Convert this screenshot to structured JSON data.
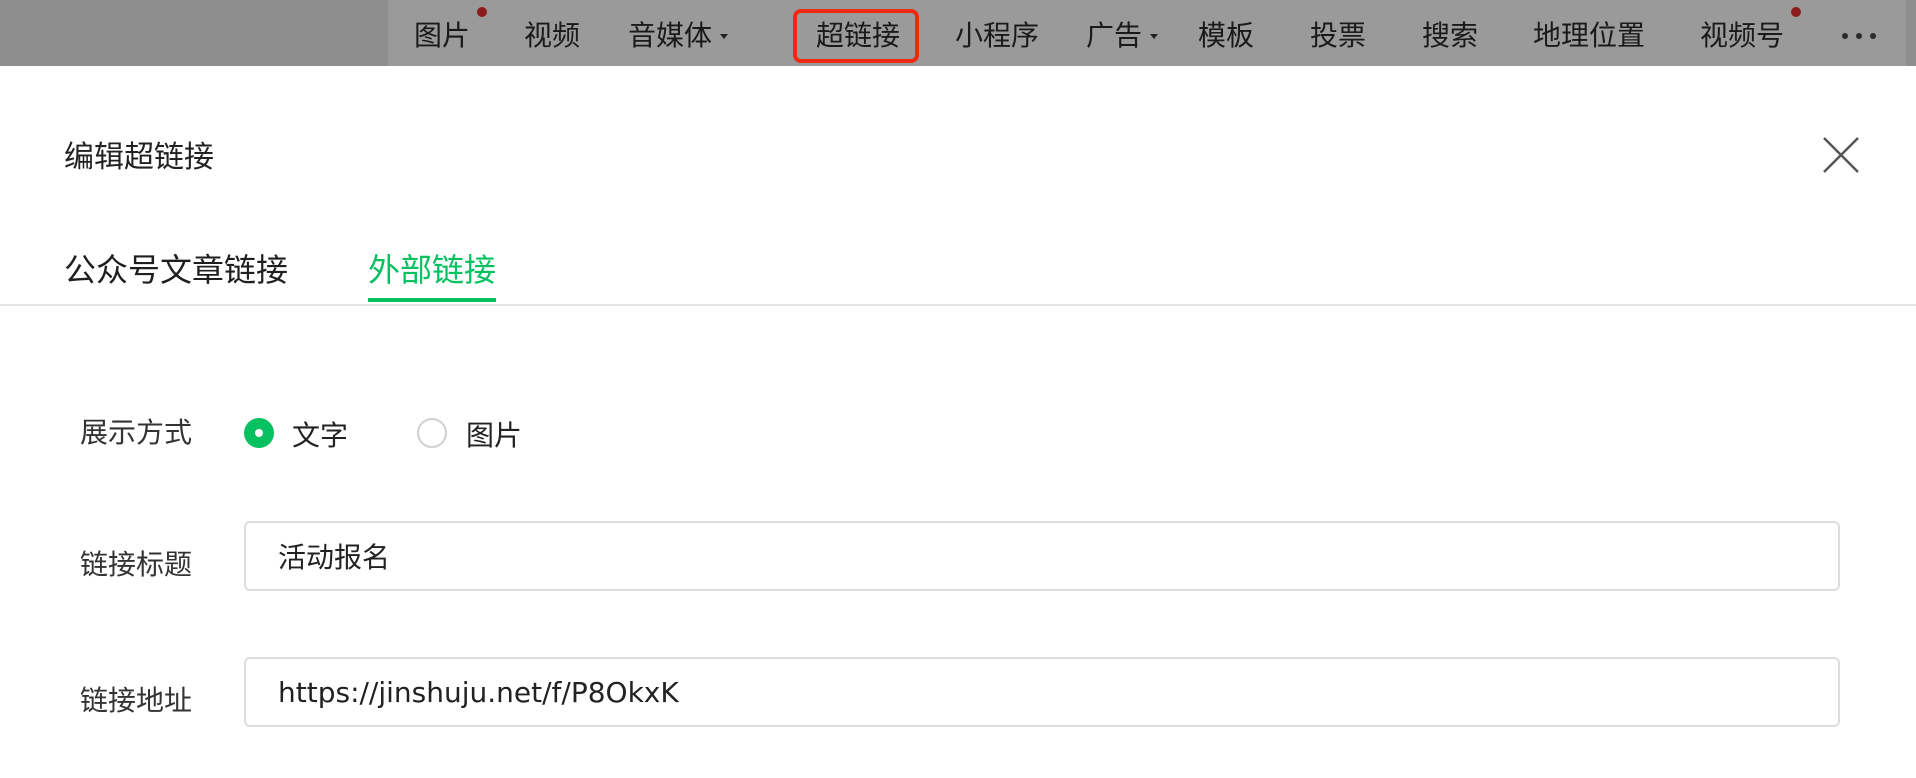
{
  "toolbar": {
    "items": [
      {
        "label": "图片",
        "dot": true
      },
      {
        "label": "视频"
      },
      {
        "label": "音媒体",
        "dropdown": true
      },
      {
        "label": "超链接",
        "highlighted": true
      },
      {
        "label": "小程序"
      },
      {
        "label": "广告",
        "dropdown": true
      },
      {
        "label": "模板"
      },
      {
        "label": "投票"
      },
      {
        "label": "搜索"
      },
      {
        "label": "地理位置"
      },
      {
        "label": "视频号",
        "dot": true
      }
    ],
    "more_icon": "more-horizontal-icon",
    "highlight_color": "#f02a12"
  },
  "dialog": {
    "title": "编辑超链接",
    "close_icon": "close-icon",
    "tabs": [
      {
        "label": "公众号文章链接",
        "active": false
      },
      {
        "label": "外部链接",
        "active": true
      }
    ],
    "accent_color": "#07c160",
    "display_mode": {
      "label": "展示方式",
      "options": [
        {
          "label": "文字",
          "selected": true
        },
        {
          "label": "图片",
          "selected": false
        }
      ]
    },
    "link_title": {
      "label": "链接标题",
      "value": "活动报名"
    },
    "link_url": {
      "label": "链接地址",
      "value": "https://jinshuju.net/f/P8OkxK"
    }
  }
}
